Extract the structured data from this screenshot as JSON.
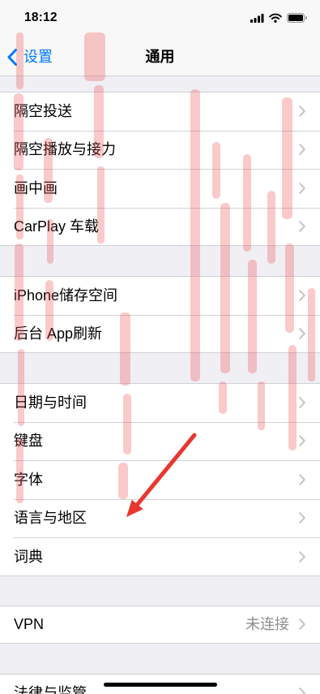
{
  "status_bar": {
    "time": "18:12",
    "icons": [
      "signal-icon",
      "wifi-icon",
      "battery-icon"
    ]
  },
  "nav": {
    "back_icon": "chevron-left-icon",
    "back_label": "设置",
    "title": "通用"
  },
  "groups": [
    {
      "rows": [
        {
          "label": "隔空投送"
        },
        {
          "label": "隔空播放与接力"
        },
        {
          "label": "画中画"
        },
        {
          "label": "CarPlay 车载"
        }
      ]
    },
    {
      "rows": [
        {
          "label": "iPhone储存空间"
        },
        {
          "label": "后台 App刷新"
        }
      ]
    },
    {
      "rows": [
        {
          "label": "日期与时间"
        },
        {
          "label": "键盘"
        },
        {
          "label": "字体"
        },
        {
          "label": "语言与地区"
        },
        {
          "label": "词典"
        }
      ]
    },
    {
      "rows": [
        {
          "label": "VPN",
          "value": "未连接"
        }
      ]
    },
    {
      "rows": [
        {
          "label": "法律与监管"
        }
      ]
    }
  ],
  "row_icon": "chevron-right-icon",
  "colors": {
    "accent": "#007aff",
    "grouped_background": "#efeff4",
    "header_background": "#f8f8f8",
    "separator": "#d1d1d6",
    "secondary_text": "#8e8e93",
    "chevron": "#c4c4c9",
    "annotation_arrow": "#e8372f",
    "watermark": "#f05050"
  }
}
